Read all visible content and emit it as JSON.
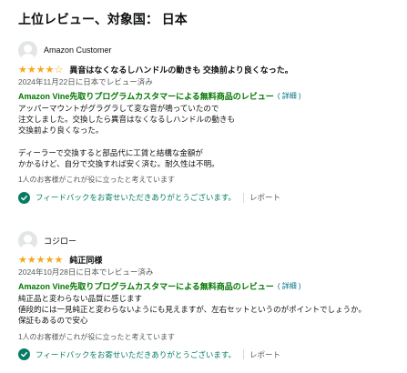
{
  "section": {
    "title": "上位レビュー、対象国： 日本"
  },
  "reviews": [
    {
      "author": "Amazon Customer",
      "rating": 4,
      "rating_max": 5,
      "title": "異音はなくなるしハンドルの動きも 交換前より良くなった。",
      "date": "2024年11月22日に日本でレビュー済み",
      "vine_badge": "Amazon Vine先取りプログラムカスタマーによる無料商品のレビュー",
      "vine_details": "( 詳細 )",
      "body": "アッパーマウントがグラグラして変な音が鳴っていたので\n注文しました。交換したら異音はなくなるしハンドルの動きも\n交換前より良くなった。\n\nディーラーで交換すると部品代に工賃と結構な金額が\nかかるけど、自分で交換すれば安く済む。耐久性は不明。",
      "helpful": "1人のお客様がこれが役に立ったと考えています",
      "feedback": "フィードバックをお寄せいただきありがとうございます。",
      "report": "レポート"
    },
    {
      "author": "コジロー",
      "rating": 5,
      "rating_max": 5,
      "title": "純正同様",
      "date": "2024年10月28日に日本でレビュー済み",
      "vine_badge": "Amazon Vine先取りプログラムカスタマーによる無料商品のレビュー",
      "vine_details": "( 詳細 )",
      "body": "純正品と変わらない品質に感じます\n値段的には一見純正と変わらないようにも見えますが、左右セットというのがポイントでしょうか。\n保証もあるので安心",
      "helpful": "1人のお客様がこれが役に立ったと考えています",
      "feedback": "フィードバックをお寄せいただきありがとうございます。",
      "report": "レポート"
    }
  ],
  "colors": {
    "star": "#f7a71c",
    "vine_green": "#007600",
    "link_teal": "#007185",
    "feedback_green": "#067d62",
    "secondary_text": "#565959"
  },
  "icons": {
    "avatar": "avatar-icon",
    "star": "star-icon",
    "check": "check-circle-icon"
  }
}
